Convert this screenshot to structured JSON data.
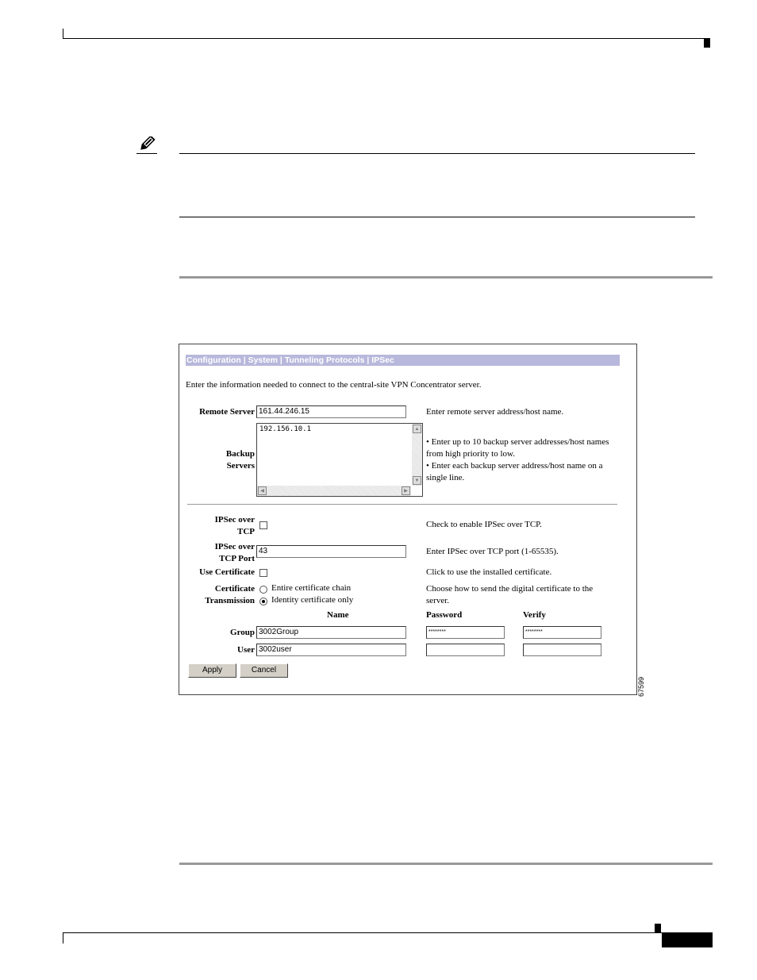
{
  "figure": {
    "breadcrumb": "Configuration | System | Tunneling Protocols | IPSec",
    "intro": "Enter the information needed to connect to the central-site VPN Concentrator server.",
    "figure_id": "67599",
    "remote_server": {
      "label": "Remote Server",
      "value": "161.44.246.15",
      "help": "Enter remote server address/host name."
    },
    "backup_servers": {
      "label_line1": "Backup",
      "label_line2": "Servers",
      "value": "192.156.10.1",
      "help_bullet1": "•  Enter up to 10 backup server addresses/host names from high priority to low.",
      "help_bullet2": "•  Enter each backup server address/host name on a single line."
    },
    "ipsec_over_tcp": {
      "label_line1": "IPSec over",
      "label_line2": "TCP",
      "checked": false,
      "help": "Check to enable IPSec over TCP."
    },
    "ipsec_tcp_port": {
      "label_line1": "IPSec over",
      "label_line2": "TCP Port",
      "value": "43",
      "help": "Enter IPSec over TCP port (1-65535)."
    },
    "use_certificate": {
      "label": "Use Certificate",
      "checked": false,
      "help": "Click to use the installed certificate."
    },
    "cert_transmission": {
      "label_line1": "Certificate",
      "label_line2": "Transmission",
      "options": [
        "Entire certificate chain",
        "Identity certificate only"
      ],
      "selected": "Identity certificate only",
      "help": "Choose how to send the digital certificate to the server."
    },
    "credentials": {
      "columns": [
        "Name",
        "Password",
        "Verify"
      ],
      "rows": [
        {
          "label": "Group",
          "name": "3002Group",
          "password": "********",
          "verify": "********"
        },
        {
          "label": "User",
          "name": "3002user",
          "password": "",
          "verify": ""
        }
      ]
    },
    "buttons": {
      "apply": "Apply",
      "cancel": "Cancel"
    }
  },
  "icons": {
    "note": "pencil-icon"
  }
}
